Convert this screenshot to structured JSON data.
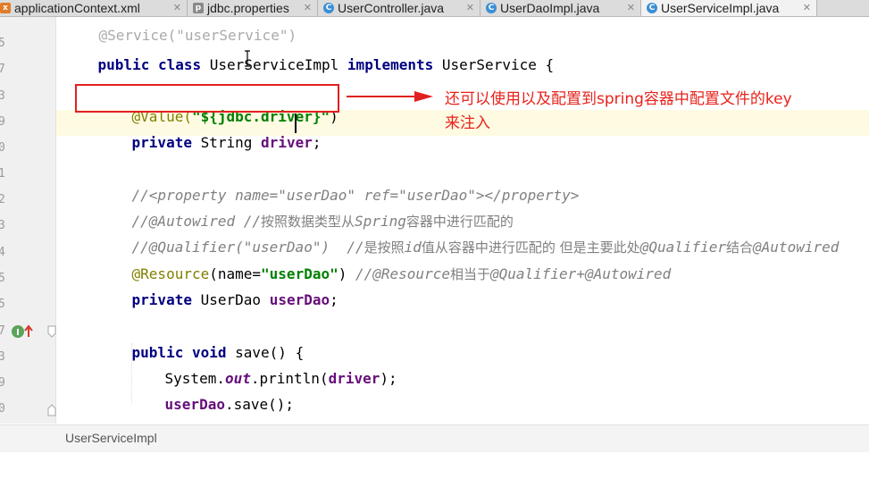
{
  "tabs": [
    {
      "label": "applicationContext.xml",
      "icon": "xml-file-icon"
    },
    {
      "label": "jdbc.properties",
      "icon": "properties-file-icon"
    },
    {
      "label": "UserController.java",
      "icon": "class-file-icon"
    },
    {
      "label": "UserDaoImpl.java",
      "icon": "class-file-icon"
    },
    {
      "label": "UserServiceImpl.java",
      "icon": "class-file-icon",
      "active": true
    }
  ],
  "gutter": {
    "line_numbers": [
      "5",
      "7",
      "3",
      "9",
      "0",
      "1",
      "2",
      "3",
      "4",
      "5",
      "5",
      "7",
      "3",
      "9",
      "0"
    ]
  },
  "code": {
    "line0": {
      "top_text": "@Service(\"userService\")"
    },
    "line1": {
      "k1": "public",
      "k2": "class",
      "name": "UserServiceImpl",
      "k3": "implements",
      "iface": "UserService",
      "brace": "{"
    },
    "line3": {
      "ann": "@Value(",
      "str": "\"${jdbc.driver}\"",
      "close": ")"
    },
    "line4": {
      "k": "private",
      "type": "String",
      "fld": "driver",
      "semi": ";"
    },
    "line6": {
      "c": "//<property name=\"userDao\" ref=\"userDao\"></property>"
    },
    "line7": {
      "c1": "//@Autowired //",
      "cn1": "按照数据类型从",
      "c2": "Spring",
      "cn2": "容器中进行匹配的"
    },
    "line8": {
      "c1": "//@Qualifier(\"userDao\")  //",
      "cn1": "是按照",
      "c2": "id",
      "cn2": "值从容器中进行匹配的 但是主要此处",
      "c3": "@Qualifier",
      "cn3": "结合",
      "c4": "@Autowired"
    },
    "line9": {
      "ann": "@Resource",
      "p1": "(name=",
      "str": "\"userDao\"",
      "p2": ") ",
      "c1": "//@Resource",
      "cn1": "相当于",
      "c2": "@Qualifier+@Autowired"
    },
    "line10": {
      "k": "private",
      "type": "UserDao",
      "fld": "userDao",
      "semi": ";"
    },
    "line12": {
      "k1": "public",
      "k2": "void",
      "name": "save() {"
    },
    "line13": {
      "a": "System.",
      "b": "out",
      "c": ".println(",
      "d": "driver",
      "e": ");"
    },
    "line14": {
      "a": "userDao",
      "b": ".save();"
    },
    "line15": {
      "a": "}"
    }
  },
  "annotation_note": {
    "line1": "还可以使用以及配置到spring容器中配置文件的key",
    "line2": "来注入"
  },
  "breadcrumb": "UserServiceImpl",
  "colors": {
    "keyword": "#000080",
    "annotation": "#808000",
    "string": "#008000",
    "field": "#660e7a",
    "comment": "#808080",
    "highlight": "#e02020"
  }
}
